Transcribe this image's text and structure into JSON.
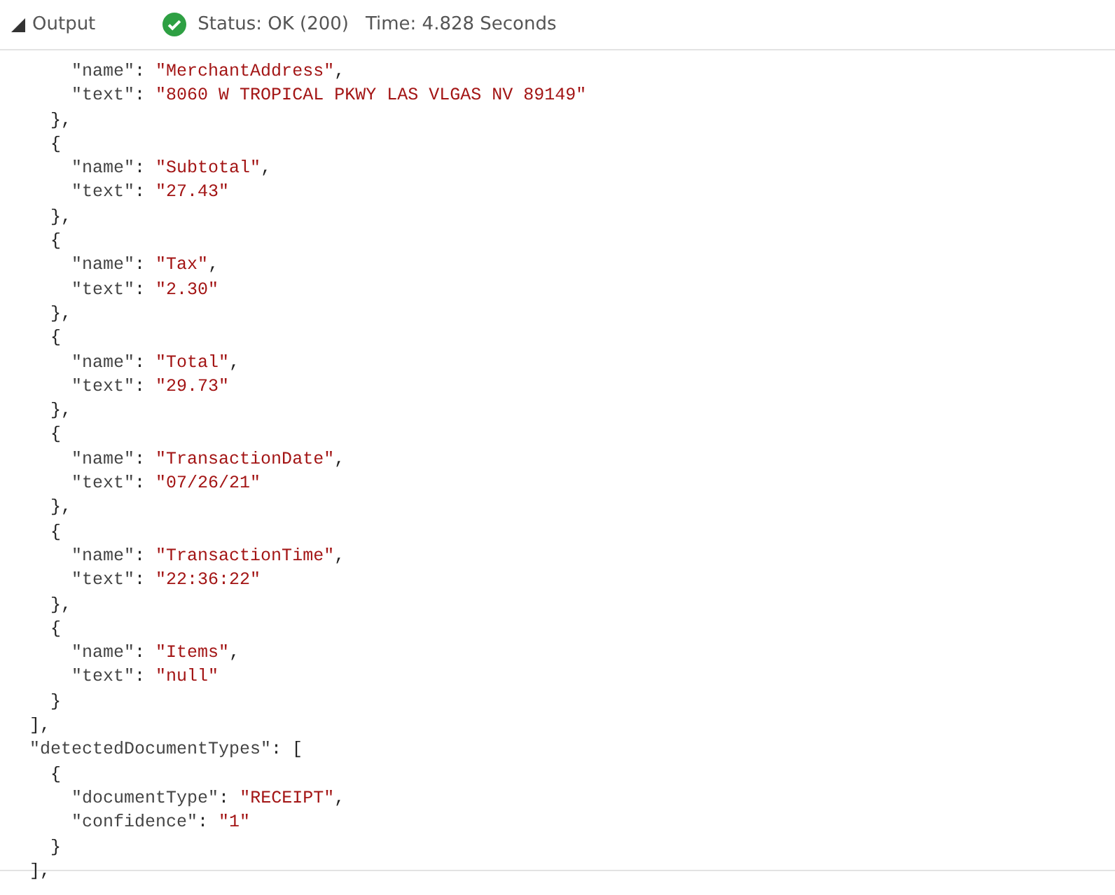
{
  "header": {
    "title": "Output",
    "status": "Status: OK (200)",
    "time": "Time: 4.828 Seconds",
    "ok": true
  },
  "lines": [
    "    \"name\": \"MerchantAddress\",",
    "    \"text\": \"8060 W TROPICAL PKWY LAS VLGAS NV 89149\"",
    "  },",
    "  {",
    "    \"name\": \"Subtotal\",",
    "    \"text\": \"27.43\"",
    "  },",
    "  {",
    "    \"name\": \"Tax\",",
    "    \"text\": \"2.30\"",
    "  },",
    "  {",
    "    \"name\": \"Total\",",
    "    \"text\": \"29.73\"",
    "  },",
    "  {",
    "    \"name\": \"TransactionDate\",",
    "    \"text\": \"07/26/21\"",
    "  },",
    "  {",
    "    \"name\": \"TransactionTime\",",
    "    \"text\": \"22:36:22\"",
    "  },",
    "  {",
    "    \"name\": \"Items\",",
    "    \"text\": \"null\"",
    "  }",
    "],",
    "\"detectedDocumentTypes\": [",
    "  {",
    "    \"documentType\": \"RECEIPT\",",
    "    \"confidence\": \"1\"",
    "  }",
    "],"
  ]
}
